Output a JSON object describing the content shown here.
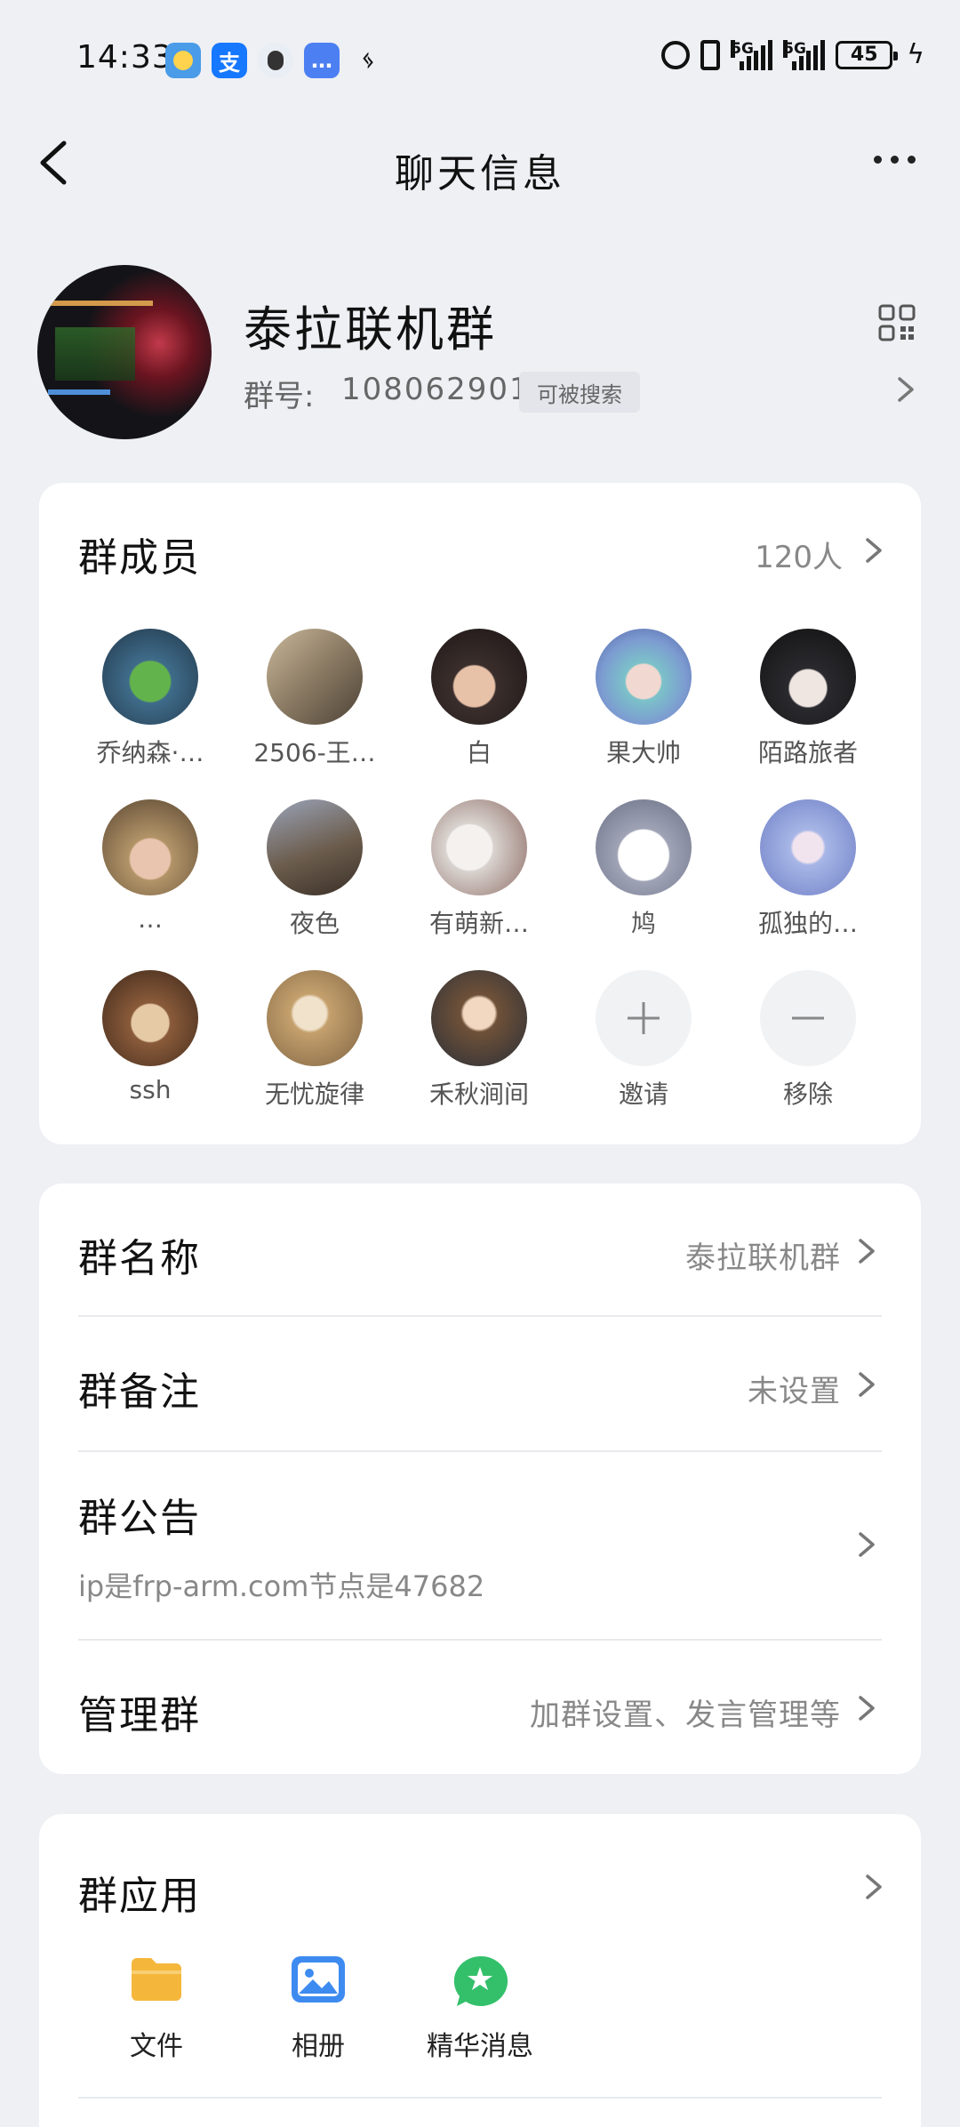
{
  "status_bar": {
    "time": "14:33",
    "network_1": "5G",
    "network_2": "5G",
    "battery": "45"
  },
  "nav": {
    "title": "聊天信息"
  },
  "group": {
    "name": "泰拉联机群",
    "id_label": "群号:",
    "id": "1080629010",
    "searchable_badge": "可被搜索"
  },
  "members": {
    "title": "群成员",
    "count": "120人",
    "list": [
      {
        "name": "乔纳森·…",
        "color": "#3f6c8a"
      },
      {
        "name": "2506-王…",
        "color": "#8a7a63"
      },
      {
        "name": "白",
        "color": "#3a2e2c"
      },
      {
        "name": "果大帅",
        "color": "#7c9bd1"
      },
      {
        "name": "陌路旅者",
        "color": "#2a2a2e"
      },
      {
        "name": "…",
        "color": "#b29468"
      },
      {
        "name": "夜色",
        "color": "#6b5c4c"
      },
      {
        "name": "有萌新…",
        "color": "#d9d3cf"
      },
      {
        "name": "鸠",
        "color": "#9fa3b5"
      },
      {
        "name": "孤独的…",
        "color": "#a7b6e6"
      },
      {
        "name": "ssh",
        "color": "#8a5b3a"
      },
      {
        "name": "无忧旋律",
        "color": "#c4a06d"
      },
      {
        "name": "禾秋涧间",
        "color": "#6f5138"
      }
    ],
    "invite_label": "邀请",
    "remove_label": "移除"
  },
  "settings": {
    "group_name": {
      "title": "群名称",
      "value": "泰拉联机群"
    },
    "group_remark": {
      "title": "群备注",
      "value": "未设置"
    },
    "announcement": {
      "title": "群公告",
      "value": "ip是frp-arm.com节点是47682"
    },
    "manage": {
      "title": "管理群",
      "value": "加群设置、发言管理等"
    }
  },
  "apps": {
    "title": "群应用",
    "items": [
      {
        "label": "文件",
        "color": "#f5b73b"
      },
      {
        "label": "相册",
        "color": "#3d8bf0"
      },
      {
        "label": "精华消息",
        "color": "#34c06b"
      }
    ]
  }
}
